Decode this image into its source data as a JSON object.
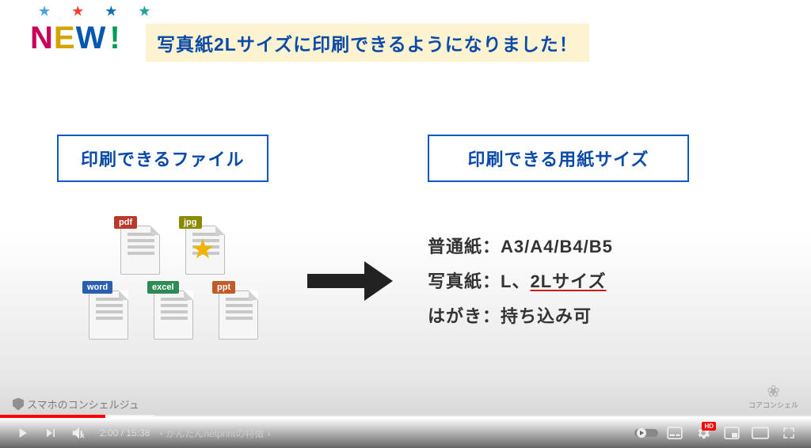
{
  "badge": {
    "text": "NEW!",
    "stars": "★★★★"
  },
  "headline": "写真紙2Lサイズに印刷できるようになりました！",
  "sections": {
    "left_title": "印刷できるファイル",
    "right_title": "印刷できる用紙サイズ"
  },
  "file_tags": {
    "pdf": "pdf",
    "jpg": "jpg",
    "word": "word",
    "excel": "excel",
    "ppt": "ppt"
  },
  "paper_sizes": {
    "line1_label": "普通紙：",
    "line1_value": "A3/A4/B4/B5",
    "line2_label": "写真紙：",
    "line2_value_a": "L、",
    "line2_value_b": "2Lサイズ",
    "line3_label": "はがき：",
    "line3_value": "持ち込み可"
  },
  "corner_logo": "コアコンシェル",
  "watermark": "スマホのコンシェルジュ",
  "player": {
    "time_current": "2:00",
    "time_total": "15:38",
    "chapter": "・かんたんnetprintの特徴",
    "chapter_caret": "›",
    "hd": "HD",
    "progress_percent": 13,
    "loaded_percent": 19
  }
}
